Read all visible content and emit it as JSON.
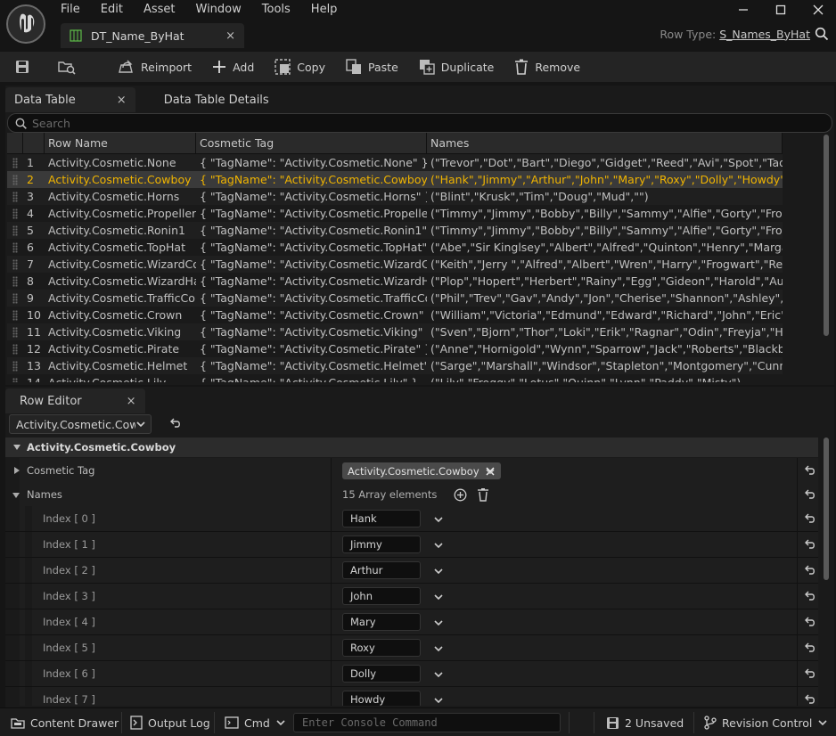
{
  "menu": [
    "File",
    "Edit",
    "Asset",
    "Window",
    "Tools",
    "Help"
  ],
  "document_tab": {
    "label": "DT_Name_ByHat",
    "close": "×"
  },
  "row_type": {
    "label": "Row Type:",
    "value": "S_Names_ByHat"
  },
  "toolbar": {
    "reimport": "Reimport",
    "add": "Add",
    "copy": "Copy",
    "paste": "Paste",
    "duplicate": "Duplicate",
    "remove": "Remove"
  },
  "panel_tabs": {
    "data_table": "Data Table",
    "details": "Data Table Details",
    "close": "×"
  },
  "search": {
    "placeholder": "Search"
  },
  "table": {
    "headers": {
      "row_name": "Row Name",
      "tag": "Cosmetic Tag",
      "names": "Names"
    },
    "selected_index": 1,
    "rows": [
      {
        "num": "1",
        "name": "Activity.Cosmetic.None",
        "tag": "{ \"TagName\": \"Activity.Cosmetic.None\" }",
        "names": "(\"Trevor\",\"Dot\",\"Bart\",\"Diego\",\"Gidget\",\"Reed\",\"Avi\",\"Spot\",\"Tad\",\"Anthony\")"
      },
      {
        "num": "2",
        "name": "Activity.Cosmetic.Cowboy",
        "tag": "{ \"TagName\": \"Activity.Cosmetic.Cowboy\" }",
        "names": "(\"Hank\",\"Jimmy\",\"Arthur\",\"John\",\"Mary\",\"Roxy\",\"Dolly\",\"Howdy\",\"Dusty\",\"Wre"
      },
      {
        "num": "3",
        "name": "Activity.Cosmetic.Horns",
        "tag": "{ \"TagName\": \"Activity.Cosmetic.Horns\" }",
        "names": "(\"Blint\",\"Krusk\",\"Tim\",\"Doug\",\"Mud\",\"\")"
      },
      {
        "num": "4",
        "name": "Activity.Cosmetic.Propeller",
        "tag": "{ \"TagName\": \"Activity.Cosmetic.Propeller\" }",
        "names": "(\"Timmy\",\"Jimmy\",\"Bobby\",\"Billy\",\"Sammy\",\"Alfie\",\"Gorty\",\"Froggy\",\"Toadle\","
      },
      {
        "num": "5",
        "name": "Activity.Cosmetic.Ronin1",
        "tag": "{ \"TagName\": \"Activity.Cosmetic.Ronin1\" }",
        "names": "(\"Timmy\",\"Jimmy\",\"Bobby\",\"Billy\",\"Sammy\",\"Alfie\",\"Gorty\",\"Froggy\",\"Toadle\","
      },
      {
        "num": "6",
        "name": "Activity.Cosmetic.TopHat",
        "tag": "{ \"TagName\": \"Activity.Cosmetic.TopHat\" }",
        "names": "(\"Abe\",\"Sir Kinglsey\",\"Albert\",\"Alfred\",\"Quinton\",\"Henry\",\"Margaret\",\"William\""
      },
      {
        "num": "7",
        "name": "Activity.Cosmetic.WizardCor",
        "tag": "{ \"TagName\": \"Activity.Cosmetic.WizardCone\" }",
        "names": "(\"Keith\",\"Jerry \",\"Alfred\",\"Albert\",\"Wren\",\"Harry\",\"Frogwart\",\"Reggie\",\"Bella\",\"I"
      },
      {
        "num": "8",
        "name": "Activity.Cosmetic.WizardHat",
        "tag": "{ \"TagName\": \"Activity.Cosmetic.WizardHat\" }",
        "names": "(\"Plop\",\"Hopert\",\"Herbert\",\"Rainy\",\"Egg\",\"Gideon\",\"Harold\",\"August\",\"Benny\","
      },
      {
        "num": "9",
        "name": "Activity.Cosmetic.TrafficCon",
        "tag": "{ \"TagName\": \"Activity.Cosmetic.TrafficCone\" }",
        "names": "(\"Phil\",\"Trev\",\"Gav\",\"Andy\",\"Jon\",\"Cherise\",\"Shannon\",\"Ashley\",\"Matty\",\"Jas\""
      },
      {
        "num": "10",
        "name": "Activity.Cosmetic.Crown",
        "tag": "{ \"TagName\": \"Activity.Cosmetic.Crown\" }",
        "names": "(\"William\",\"Victoria\",\"Edmund\",\"Edward\",\"Richard\",\"John\",\"Eric\",\"Elizabeth\","
      },
      {
        "num": "11",
        "name": "Activity.Cosmetic.Viking",
        "tag": "{ \"TagName\": \"Activity.Cosmetic.Viking\" }",
        "names": "(\"Sven\",\"Bjorn\",\"Thor\",\"Loki\",\"Erik\",\"Ragnar\",\"Odin\",\"Freyja\",\"Hel\",\"Heimdall\")"
      },
      {
        "num": "12",
        "name": "Activity.Cosmetic.Pirate",
        "tag": "{ \"TagName\": \"Activity.Cosmetic.Pirate\" }",
        "names": "(\"Anne\",\"Hornigold\",\"Wynn\",\"Sparrow\",\"Jack\",\"Roberts\",\"Blackbeard\",\"Pauls"
      },
      {
        "num": "13",
        "name": "Activity.Cosmetic.Helmet",
        "tag": "{ \"TagName\": \"Activity.Cosmetic.Helmet\" }",
        "names": "(\"Sarge\",\"Marshall\",\"Windsor\",\"Stapleton\",\"Montgomery\",\"Cunningham\",\"Ar"
      },
      {
        "num": "14",
        "name": "Activity.Cosmetic.Lily",
        "tag": "{ \"TagName\": \"Activity.Cosmetic.Lily\" }",
        "names": "(\"Lily\",\"Froggy\",\"Lotus\",\"Quinn\",\"Lynn\",\"Paddy\",\"Misty\")"
      }
    ]
  },
  "row_editor": {
    "tab_label": "Row Editor",
    "selected_row": "Activity.Cosmetic.Cowboy",
    "section_title": "Activity.Cosmetic.Cowboy",
    "cosmetic_tag_label": "Cosmetic Tag",
    "cosmetic_tag_value": "Activity.Cosmetic.Cowboy",
    "names_label": "Names",
    "names_count": "15 Array elements",
    "elements": [
      {
        "label": "Index [ 0 ]",
        "value": "Hank"
      },
      {
        "label": "Index [ 1 ]",
        "value": "Jimmy"
      },
      {
        "label": "Index [ 2 ]",
        "value": "Arthur"
      },
      {
        "label": "Index [ 3 ]",
        "value": "John"
      },
      {
        "label": "Index [ 4 ]",
        "value": "Mary"
      },
      {
        "label": "Index [ 5 ]",
        "value": "Roxy"
      },
      {
        "label": "Index [ 6 ]",
        "value": "Dolly"
      },
      {
        "label": "Index [ 7 ]",
        "value": "Howdy"
      }
    ]
  },
  "statusbar": {
    "content_drawer": "Content Drawer",
    "output_log": "Output Log",
    "cmd": "Cmd",
    "console_placeholder": "Enter Console Command",
    "unsaved": "2 Unsaved",
    "revision_control": "Revision Control"
  },
  "colors": {
    "selection_text": "#f0b400",
    "background": "#151515",
    "panel": "#1a1a1a"
  }
}
